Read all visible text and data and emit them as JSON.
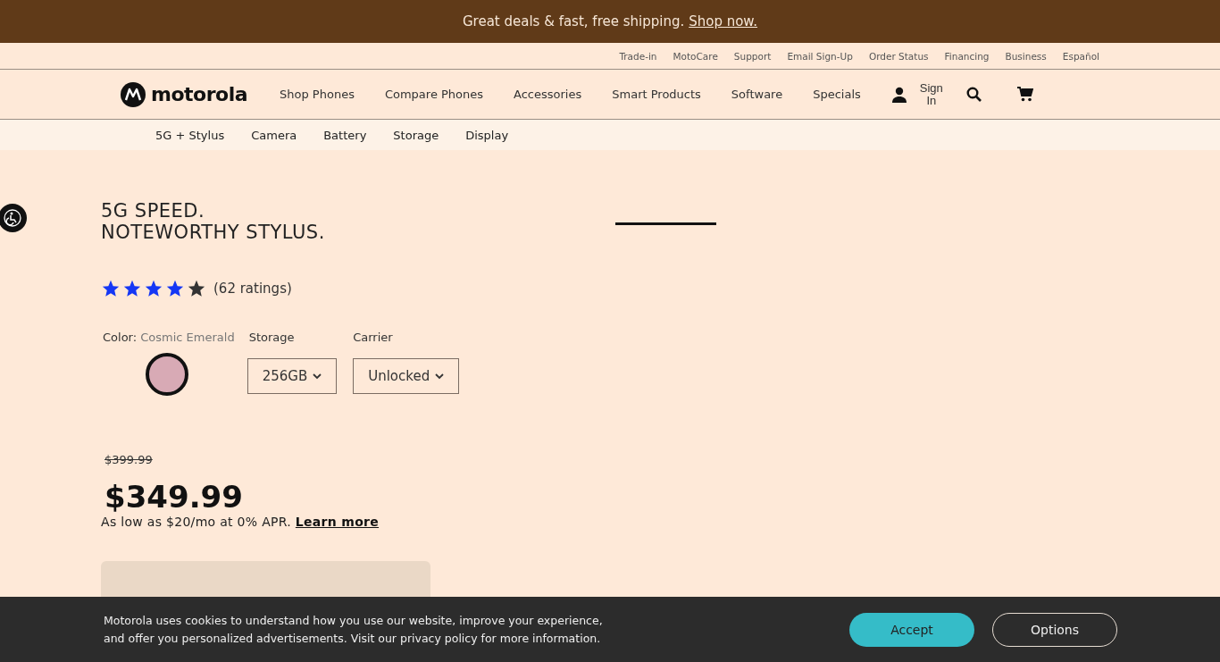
{
  "promo_banner": {
    "text": "Great deals & fast, free shipping.",
    "link": "Shop now."
  },
  "utility_nav": [
    "Trade-in",
    "MotoCare",
    "Support",
    "Email Sign-Up",
    "Order Status",
    "Financing",
    "Business",
    "Español"
  ],
  "main_nav": {
    "logo": "motorola",
    "items": [
      "Shop Phones",
      "Compare Phones",
      "Accessories",
      "Smart Products",
      "Software",
      "Specials"
    ],
    "sign_in": [
      "Sign",
      "In"
    ]
  },
  "sub_nav": [
    "5G + Stylus",
    "Camera",
    "Battery",
    "Storage",
    "Display"
  ],
  "product": {
    "headline": [
      "5G SPEED.",
      "NOTEWORTHY STYLUS."
    ],
    "stars": 4,
    "ratings": "(62 ratings)",
    "color_label": "Color:",
    "color_name": "Cosmic Emerald",
    "color_options": [
      {
        "color": "#d8aab5",
        "selected": true
      }
    ],
    "storage_label": "Storage",
    "storage_value": "256GB",
    "carrier_label": "Carrier",
    "carrier_value": "Unlocked",
    "old_price": "$399.99",
    "price": "$349.99",
    "financing": "As low as $20/mo at 0% APR.",
    "financing_link": "Learn more"
  },
  "cookie_banner": {
    "text": "Motorola uses cookies to understand how you use our website, improve your experience, and offer you personalized advertisements. Visit our privacy policy for more information.",
    "buttons": [
      "Accept",
      "Options"
    ]
  }
}
